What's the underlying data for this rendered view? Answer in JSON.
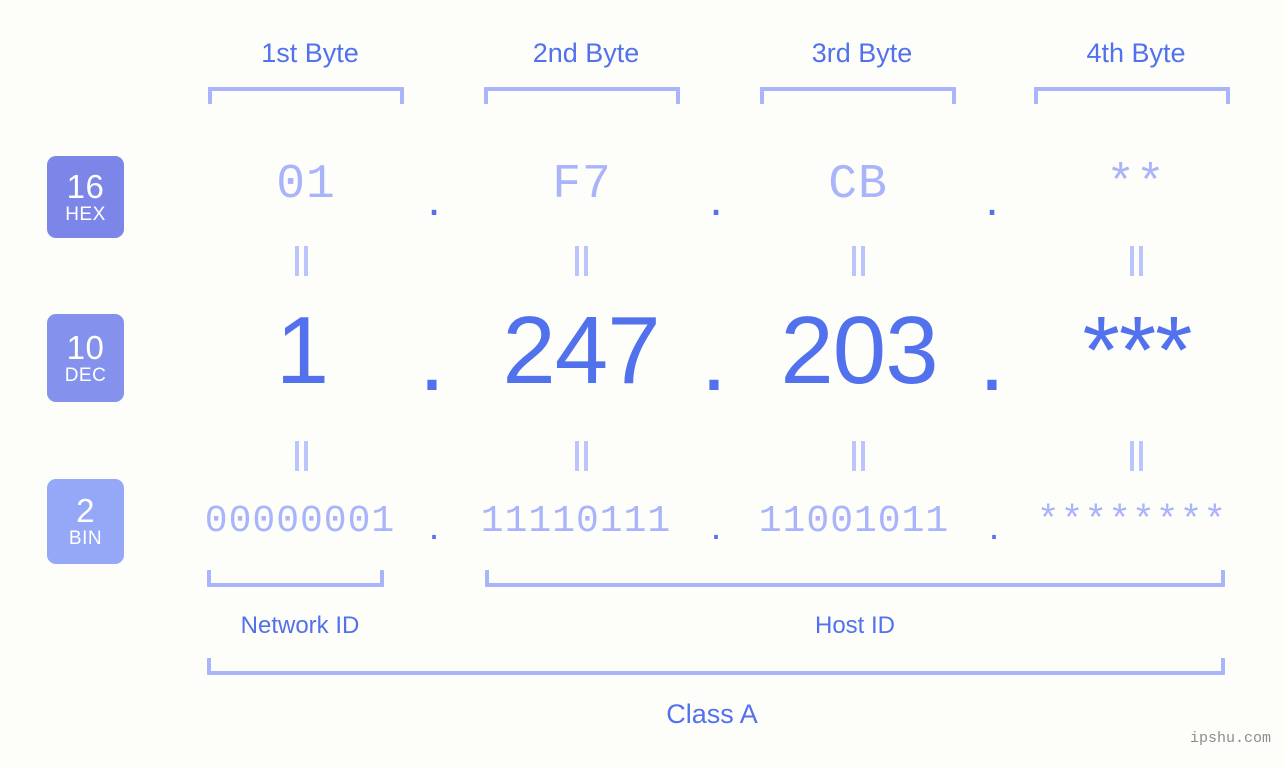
{
  "meta": {
    "background_color": "#fdfdfa",
    "accent_strong": "#5271ed",
    "accent_light": "#aab4fb",
    "badge_hex_color": "#7b86e8",
    "badge_dec_color": "#8491ed",
    "badge_bin_color": "#94a8f7",
    "watermark": "ipshu.com"
  },
  "byte_headers": [
    {
      "label": "1st Byte"
    },
    {
      "label": "2nd Byte"
    },
    {
      "label": "3rd Byte"
    },
    {
      "label": "4th Byte"
    }
  ],
  "bases": [
    {
      "number": "16",
      "name": "HEX"
    },
    {
      "number": "10",
      "name": "DEC"
    },
    {
      "number": "2",
      "name": "BIN"
    }
  ],
  "rows": {
    "hex": {
      "values": [
        "01",
        "F7",
        "CB",
        "**"
      ],
      "separator": "."
    },
    "dec": {
      "values": [
        "1",
        "247",
        "203",
        "***"
      ],
      "separator": "."
    },
    "bin": {
      "values": [
        "00000001",
        "11110111",
        "11001011",
        "********"
      ],
      "separator": "."
    }
  },
  "equals_separator": "=",
  "segments": {
    "network_id": "Network ID",
    "host_id": "Host ID",
    "class": "Class A"
  }
}
